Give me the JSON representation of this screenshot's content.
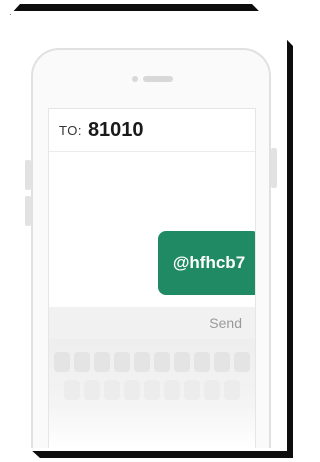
{
  "compose": {
    "to_label": "TO:",
    "to_number": "81010"
  },
  "message": {
    "text": "@hfhcb7",
    "bubble_color": "#1f8a63"
  },
  "composer": {
    "send_label": "Send"
  },
  "keyboard": {
    "rows": [
      10,
      9
    ]
  },
  "colors": {
    "accent": "#1f8a63",
    "frame": "#111111"
  }
}
